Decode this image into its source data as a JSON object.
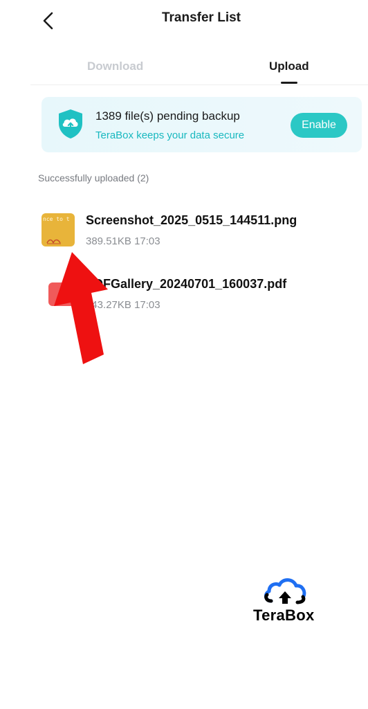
{
  "header": {
    "title": "Transfer List",
    "back_icon": "chevron-left-icon"
  },
  "tabs": [
    {
      "label": "Download",
      "active": false
    },
    {
      "label": "Upload",
      "active": true
    }
  ],
  "banner": {
    "title": "1389 file(s) pending backup",
    "subtitle": "TeraBox keeps your data secure",
    "button_label": "Enable",
    "icon": "cloud-upload-shield-icon",
    "accent_color": "#2bc8c5"
  },
  "section": {
    "title": "Successfully uploaded (2)"
  },
  "files": [
    {
      "name": "Screenshot_2025_0515_144511.png",
      "size": "389.51KB",
      "time": "17:03",
      "thumb_text": "nce to t",
      "icon": "image-thumbnail-icon"
    },
    {
      "name": "PDFGallery_20240701_160037.pdf",
      "size": "543.27KB",
      "time": "17:03",
      "icon": "pdf-file-icon"
    }
  ],
  "watermark": {
    "brand": "TeraBox",
    "icon": "terabox-cloud-logo-icon"
  }
}
